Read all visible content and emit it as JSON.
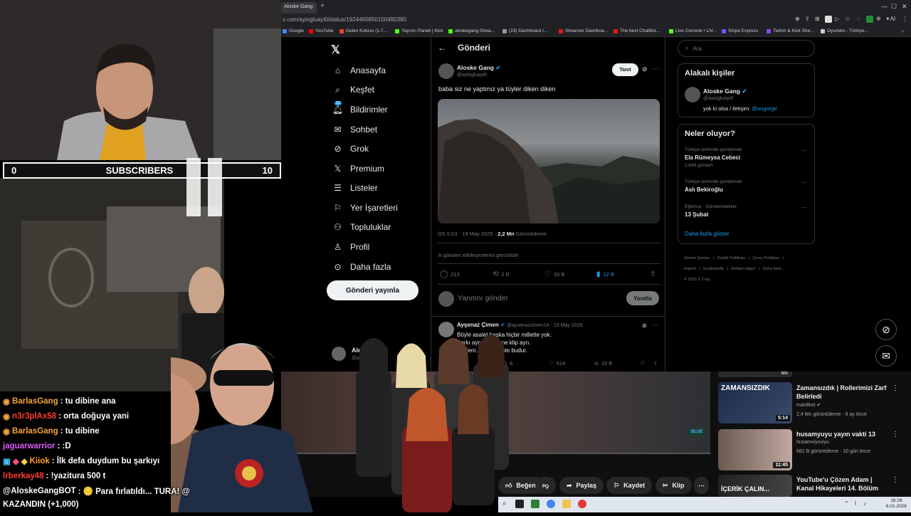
{
  "browser": {
    "tab_title": "Aloske Gang:",
    "url": "x.com/ayiogluayi0/status/1924465850150490390",
    "bookmarks": [
      "Google",
      "YouTube",
      "Gelen Kutusu (1.7...",
      "Yayıncı Paneli | Kick",
      "aloskegang Strea...",
      "(23) Dashboard /...",
      "Streamer Dashboa...",
      "The best ChatBot...",
      "Live Console • LIV...",
      "Stripe Express",
      "Twitch & Kick Stre...",
      "Oyuneks - Türkiye..."
    ],
    "ai_label": "AI"
  },
  "x": {
    "nav": [
      "Anasayfa",
      "Keşfet",
      "Bildirimler",
      "Sohbet",
      "Grok",
      "Premium",
      "Listeler",
      "Yer İşaretleri",
      "Topluluklar",
      "Profil",
      "Daha fazla"
    ],
    "notif_badge": "10",
    "post_button": "Gönderi yayınla",
    "header_title": "Gönderi",
    "tweet": {
      "author": "Aloske Gang",
      "handle": "@ayiogluayi0",
      "follow_label": "Tanıt",
      "text": "baba siz ne yaptınız ya tüyler diken diken",
      "time": "ÖS 5:03 · 19 May 2025 · ",
      "views": "2,2 Mn",
      "views_label": " Görüntüleme",
      "engagement_link": "gönderi etkileşimlerini görüntüle",
      "replies": "213",
      "retweets": "2 B",
      "likes": "33 B",
      "bookmarks": "12 B"
    },
    "reply_placeholder": "Yanıtını gönder",
    "reply_button": "Yanıtla",
    "reply2": {
      "author": "Ayşenaz Çimen",
      "handle": "@aysenazcimen14 · 19 May 2025",
      "line1": "Böyle asalet başka hiçbir millette yok.",
      "line2": "Şarkı ayrı bir efsane klip ayrı.",
      "line3": "Medeni... zarafet işte budur.",
      "replies": "3",
      "retweets": "6",
      "likes": "514",
      "views": "15 B"
    },
    "account_name": "Alosk...",
    "account_handle": "@ay...",
    "search_placeholder": "Ara",
    "related": {
      "title": "Alakalı kişiler",
      "name": "Aloske Gang",
      "handle": "@ayiogluayi0",
      "bio_prefix": "yok ki olsa / iletişim: ",
      "bio_link": "@ongorgtr"
    },
    "trends": {
      "title": "Neler oluyor?",
      "items": [
        {
          "cat": "Türkiye tarihinde gündemde",
          "name": "Ela Rümeysa Cebeci",
          "count": "2.646 gönderi"
        },
        {
          "cat": "Türkiye tarihinde gündemde",
          "name": "Aslı Bekiroğlu",
          "count": ""
        },
        {
          "cat": "Eğlence · Gündemdekiler",
          "name": "13 Şubat",
          "count": ""
        }
      ],
      "more": "Daha fazla göster"
    },
    "footer": [
      "Hizmet Şartları",
      "Gizlilik Politikası",
      "Çerez Politikası",
      "Imprint",
      "Erişilebilirlik",
      "Reklam bilgisi",
      "Daha fazla ...",
      "© 2025 X Corp."
    ]
  },
  "overlay": {
    "subs_left": "0",
    "subs_label": "SUBSCRIBERS",
    "subs_right": "10"
  },
  "chat": [
    {
      "user": "BarlasGang",
      "color": "#f4a63c",
      "msg": ": tu dibine ana"
    },
    {
      "user": "n3r3plAx58",
      "color": "#ff3b30",
      "msg": ": orta doğuya yani"
    },
    {
      "user": "BarlasGang",
      "color": "#f4a63c",
      "msg": ": tu dibine"
    },
    {
      "user": "jaguarwarrior",
      "color": "#e05cff",
      "msg": ": :D"
    },
    {
      "user": "Kiiok",
      "color": "#ffa126",
      "msg": ": İlk defa duydum bu şarkıyı"
    },
    {
      "user": "lrberkay48",
      "color": "#ff3b30",
      "msg": ": !yazitura 500 t"
    },
    {
      "user": "@AloskeGangBOT",
      "color": "#ffffff",
      "msg": ": 🪙 Para fırlatıldı... TURA! @"
    },
    {
      "user": "KAZANDIN (+1,000)",
      "color": "#ffffff",
      "msg": ""
    }
  ],
  "youtube": {
    "actions": [
      "Beğen",
      "Paylaş",
      "Kaydet",
      "Klip"
    ],
    "videos": [
      {
        "title": "Zamansızdık | Rollerimizi Zarf Belirledi",
        "channel": "manifest",
        "meta": "2,4 Mn görüntüleme · 9 ay önce",
        "duration": "5:14",
        "thumb_text": "ZAMANSIZDIK"
      },
      {
        "title": "husamyuyu yayın vakti 13",
        "channel": "husamviyuviyu",
        "meta": "681 B görüntüleme · 10 gün önce",
        "duration": "11:45",
        "thumb_text": ""
      },
      {
        "title": "YouTube'u Çözen Adam | Kanal Hikayeleri 14. Bölüm",
        "channel": "",
        "meta": "",
        "duration": "",
        "thumb_text": "İÇERİK ÇALIN..."
      }
    ],
    "mix_label": "Mix"
  },
  "taskbar": {
    "time": "16:26",
    "date": "6.01.2026"
  }
}
